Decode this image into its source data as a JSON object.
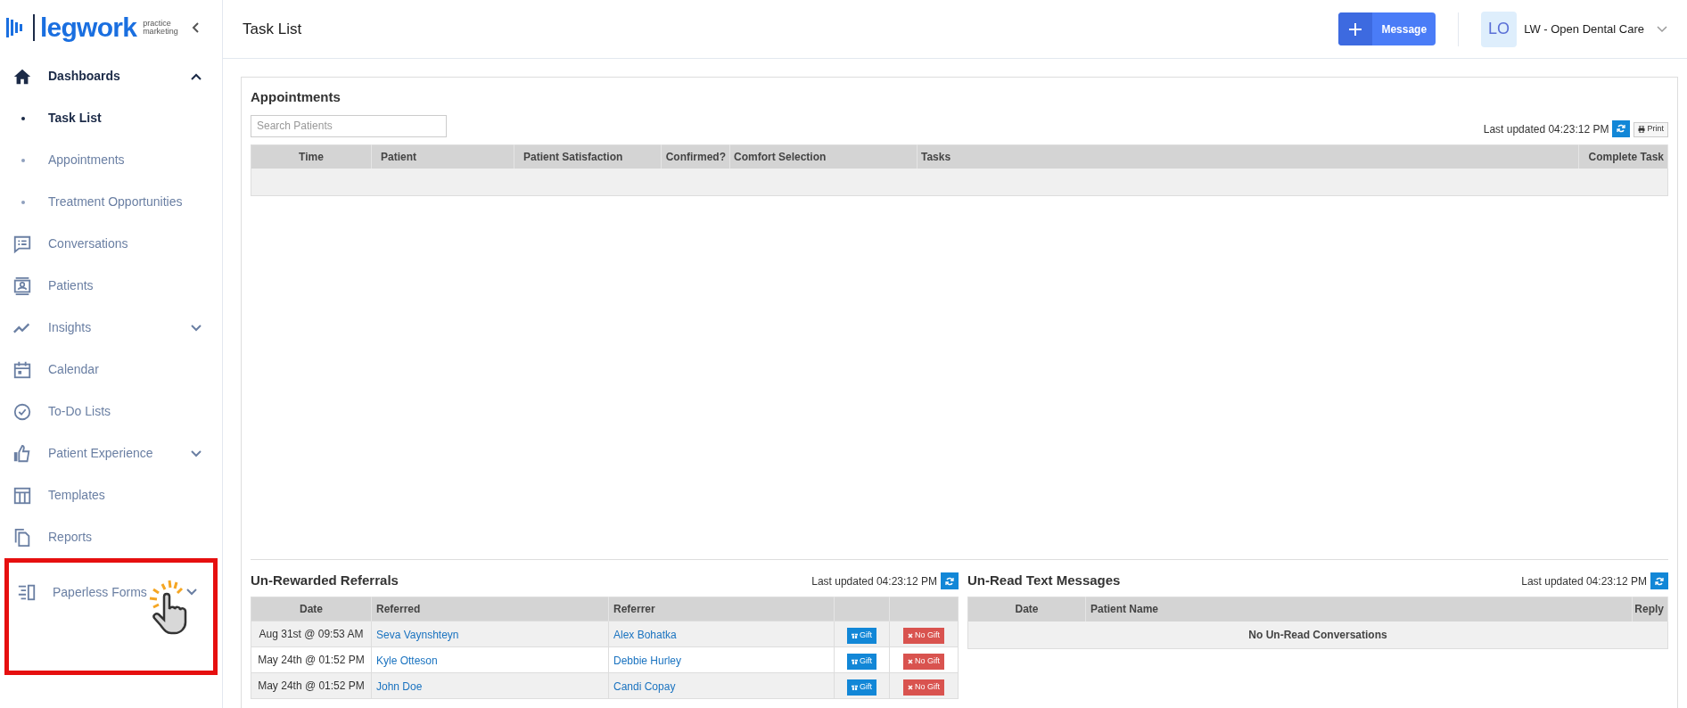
{
  "sidebar": {
    "logo": {
      "word": "legwork",
      "tagline_1": "practice",
      "tagline_2": "marketing"
    },
    "items": [
      {
        "label": "Dashboards",
        "expanded": true,
        "highlighted": false,
        "children": [
          {
            "label": "Task List",
            "selected": true
          },
          {
            "label": "Appointments",
            "selected": false
          },
          {
            "label": "Treatment Opportunities",
            "selected": false
          }
        ]
      },
      {
        "label": "Conversations",
        "highlighted": false
      },
      {
        "label": "Patients",
        "highlighted": false
      },
      {
        "label": "Insights",
        "expanded": false,
        "highlighted": false
      },
      {
        "label": "Calendar",
        "highlighted": false
      },
      {
        "label": "To-Do Lists",
        "highlighted": false
      },
      {
        "label": "Patient Experience",
        "expanded": false,
        "highlighted": false
      },
      {
        "label": "Templates",
        "highlighted": false
      },
      {
        "label": "Reports",
        "highlighted": false
      },
      {
        "label": "Paperless Forms",
        "expanded": false,
        "highlighted": true
      }
    ]
  },
  "header": {
    "title": "Task List",
    "message_button": "Message",
    "avatar": "LO",
    "account": "LW - Open Dental Care"
  },
  "appointments": {
    "heading": "Appointments",
    "search_placeholder": "Search Patients",
    "last_updated": "Last updated 04:23:12 PM",
    "print": "Print",
    "columns": [
      "Time",
      "Patient",
      "Patient Satisfaction",
      "Confirmed?",
      "Comfort Selection",
      "Tasks",
      "Complete Task"
    ]
  },
  "referrals": {
    "heading": "Un-Rewarded Referrals",
    "last_updated": "Last updated 04:23:12 PM",
    "columns": [
      "Date",
      "Referred",
      "Referrer"
    ],
    "rows": [
      {
        "date": "Aug 31st @ 09:53 AM",
        "referred": "Seva Vaynshteyn",
        "referrer": "Alex Bohatka",
        "gift": "Gift",
        "no_gift": "No Gift"
      },
      {
        "date": "May 24th @ 01:52 PM",
        "referred": "Kyle Otteson",
        "referrer": "Debbie Hurley",
        "gift": "Gift",
        "no_gift": "No Gift"
      },
      {
        "date": "May 24th @ 01:52 PM",
        "referred": "John Doe",
        "referrer": "Candi Copay",
        "gift": "Gift",
        "no_gift": "No Gift"
      }
    ]
  },
  "messages": {
    "heading": "Un-Read Text Messages",
    "last_updated": "Last updated 04:23:12 PM",
    "columns": [
      "Date",
      "Patient Name",
      "Reply"
    ],
    "empty": "No Un-Read Conversations"
  }
}
